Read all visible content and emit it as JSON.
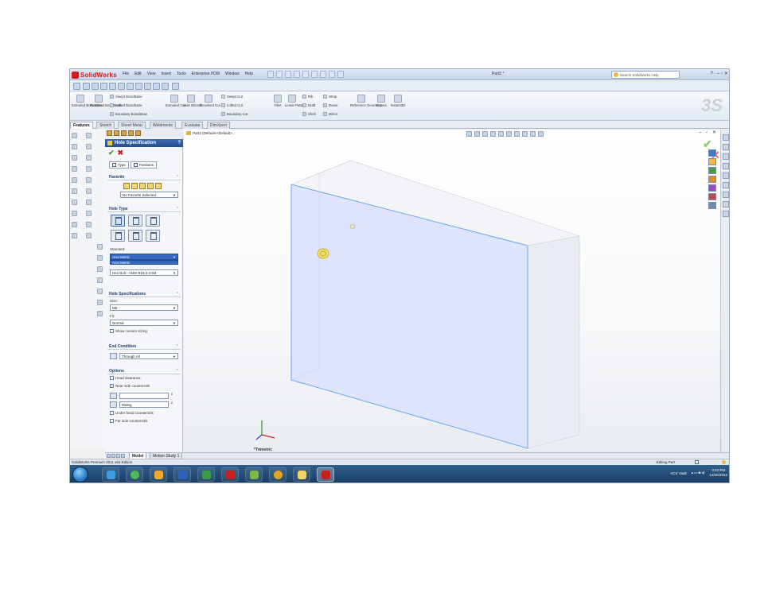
{
  "app": {
    "brand": "SolidWorks",
    "document_title": "Part3 *",
    "search_placeholder": "Search SolidWorks Help",
    "window_controls": "?  ·  –  ▫  ✕",
    "menu": [
      "File",
      "Edit",
      "View",
      "Insert",
      "Tools",
      "Enterprise PDM",
      "Window",
      "Help"
    ]
  },
  "ribbon": {
    "extruded_boss": "Extruded Boss/Base",
    "revolved_boss": "Revolved Boss/Base",
    "swept_boss": "Swept Boss/Base",
    "lofted_boss": "Lofted Boss/Base",
    "boundary_boss": "Boundary Boss/Base",
    "extruded_cut": "Extruded Cut",
    "hole_wizard": "Hole Wizard",
    "revolved_cut": "Revolved Cut",
    "swept_cut": "Swept Cut",
    "lofted_cut": "Lofted Cut",
    "boundary_cut": "Boundary Cut",
    "fillet": "Fillet",
    "linear_pattern": "Linear Pattern",
    "rib": "Rib",
    "draft": "Draft",
    "shell": "Shell",
    "wrap": "Wrap",
    "dome": "Dome",
    "mirror": "Mirror",
    "reference_geometry": "Reference Geometry",
    "curves": "Curves",
    "instant3d": "Instant3D"
  },
  "tabs": [
    "Features",
    "Sketch",
    "Sheet Metal",
    "Weldments",
    "Evaluate",
    "DimXpert"
  ],
  "property_manager": {
    "title": "Hole Specification",
    "help": "?",
    "ok": "✔",
    "cancel": "✖",
    "tab_type": "Type",
    "tab_positions": "Positions",
    "favorite": {
      "heading": "Favorite",
      "selected": "No Favorite Selected"
    },
    "hole_type": {
      "heading": "Hole Type",
      "standard_label": "Standard:",
      "standard_value": "Ansi Metric",
      "standard_dropdown_option": "Ansi Metric",
      "type_value": "Hex Bolt - ANSI B18.2.3.5M"
    },
    "hole_specifications": {
      "heading": "Hole Specifications",
      "size_label": "Size:",
      "size_value": "M5",
      "fit_label": "Fit:",
      "fit_value": "Normal",
      "custom_sizing": "Show custom sizing"
    },
    "end_condition": {
      "heading": "End Condition",
      "value": "Through All"
    },
    "options": {
      "heading": "Options",
      "head_clearance": "Head clearance",
      "near_side_countersink": "Near side countersink",
      "angle_value": "90deg",
      "under_head_countersink": "Under head countersink",
      "far_side_countersink": "Far side countersink"
    }
  },
  "viewport": {
    "tree_label": "Part3  (Default<<Default>...",
    "view_orientation": "*Trimetric",
    "window_buttons": "– ▫ ✕",
    "confirm_ok": "✔",
    "confirm_cancel": "✕"
  },
  "bottom_tabs": [
    "Model",
    "Motion Study 1"
  ],
  "status": {
    "left": "SolidWorks Premium 2011 x64 Edition",
    "right": "Editing Part"
  },
  "taskbar": {
    "tray_label": "ACS Vault",
    "time": "3:22 PM",
    "date": "12/26/2012"
  },
  "colors": {
    "part_face_front": "#dfe3fb",
    "part_edge": "#5aa4f0",
    "property_title": "#2c5aa0",
    "taskbar": "#1f4a75"
  }
}
